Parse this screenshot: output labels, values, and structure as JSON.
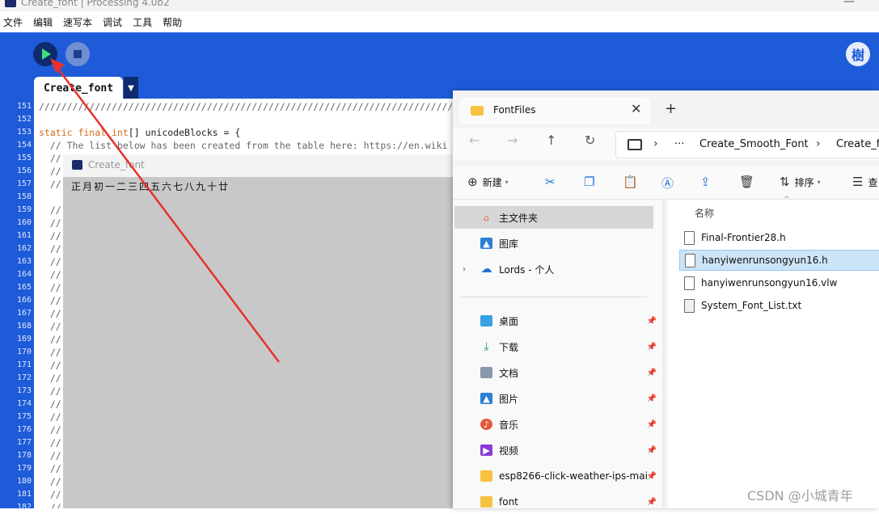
{
  "ide": {
    "window_title": "Create_font | Processing 4.0b2",
    "menu": [
      "文件",
      "编辑",
      "速写本",
      "调试",
      "工具",
      "帮助"
    ],
    "tab_label": "Create_font",
    "tab_menu_glyph": "▼",
    "mode_glyph": "樹",
    "line_numbers": [
      "151",
      "152",
      "153",
      "154",
      "155",
      "156",
      "157",
      "158",
      "159",
      "160",
      "161",
      "162",
      "163",
      "164",
      "165",
      "166",
      "167",
      "168",
      "169",
      "170",
      "171",
      "172",
      "173",
      "174",
      "175",
      "176",
      "177",
      "178",
      "179",
      "180",
      "181",
      "182"
    ],
    "code": {
      "l151": "//////////////////////////////////////////////////////////////////////////",
      "l153_kw1": "static final int",
      "l153_rest": "[] unicodeBlocks = {",
      "l154": "  // The list below has been created from the table here: https://en.wiki",
      "l155": "  //",
      "l156": "  //",
      "l157": "  //",
      "l159": "  //",
      "l160": "  //",
      "l161_182": "  //("
    }
  },
  "sketch": {
    "title": "Create_font",
    "rendered_text": "正月初一二三四五六七八九十廿"
  },
  "explorer": {
    "tab_title": "FontFiles",
    "close_glyph": "✕",
    "new_tab_glyph": "+",
    "nav": {
      "back": "←",
      "forward": "→",
      "up": "↑",
      "refresh": "↻"
    },
    "breadcrumb": [
      "Create_Smooth_Font",
      "Create_fo"
    ],
    "breadcrumb_more": "···",
    "breadcrumb_sep": "›",
    "commands": {
      "new": "新建",
      "sort": "排序",
      "more": "查"
    },
    "column_name": "名称",
    "sidebar": [
      {
        "label": "主文件夹",
        "icon": "home-icon"
      },
      {
        "label": "图库",
        "icon": "gallery-icon"
      },
      {
        "label": "Lords - 个人",
        "icon": "onedrive-icon"
      },
      {
        "label": "桌面",
        "icon": "desktop-icon"
      },
      {
        "label": "下载",
        "icon": "download-icon"
      },
      {
        "label": "文档",
        "icon": "documents-icon"
      },
      {
        "label": "图片",
        "icon": "pictures-icon"
      },
      {
        "label": "音乐",
        "icon": "music-icon"
      },
      {
        "label": "视频",
        "icon": "video-icon"
      },
      {
        "label": "esp8266-click-weather-ips-mai",
        "icon": "folder-icon"
      },
      {
        "label": "font",
        "icon": "folder-icon"
      }
    ],
    "files": [
      "Final-Frontier28.h",
      "hanyiwenrunsongyun16.h",
      "hanyiwenrunsongyun16.vlw",
      "System_Font_List.txt"
    ]
  },
  "watermark": "CSDN @小城青年",
  "colors": {
    "ide_blue": "#1e5bd8",
    "run_green": "#38e07a",
    "annotation_arrow": "#e8312a",
    "selection_blue": "#cce4f7"
  }
}
